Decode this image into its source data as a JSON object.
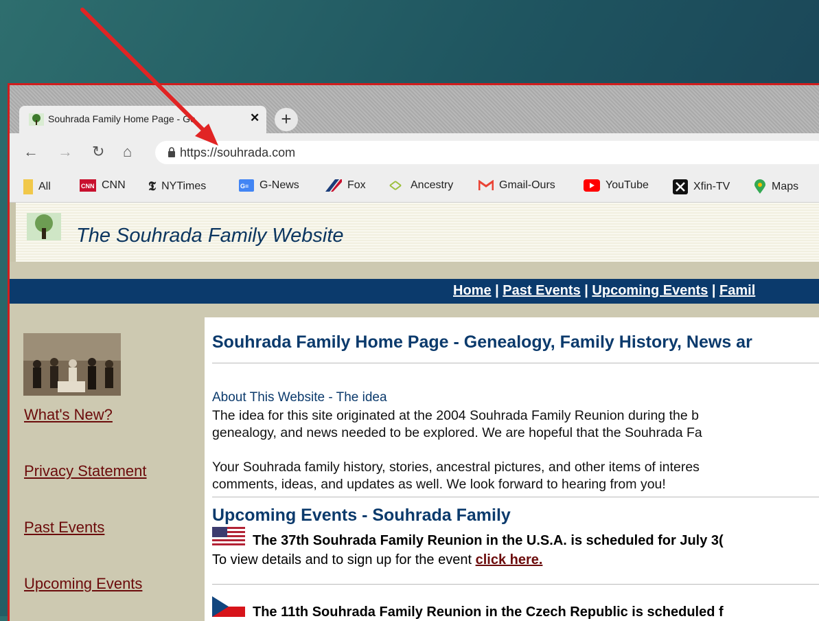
{
  "browser": {
    "tab_title": "Souhrada Family Home Page - Ge",
    "url": "https://souhrada.com",
    "bookmarks": [
      {
        "label": "All",
        "icon": "folder-icon"
      },
      {
        "label": "CNN",
        "icon": "cnn-icon"
      },
      {
        "label": "NYTimes",
        "icon": "nytimes-icon"
      },
      {
        "label": "G-News",
        "icon": "google-news-icon"
      },
      {
        "label": "Fox",
        "icon": "fox-icon"
      },
      {
        "label": "Ancestry",
        "icon": "ancestry-icon"
      },
      {
        "label": "Gmail-Ours",
        "icon": "gmail-icon"
      },
      {
        "label": "YouTube",
        "icon": "youtube-icon"
      },
      {
        "label": "Xfin-TV",
        "icon": "x-icon"
      },
      {
        "label": "Maps",
        "icon": "maps-icon"
      }
    ]
  },
  "site": {
    "title": "The Souhrada Family Website",
    "nav": [
      "Home",
      "Past Events",
      "Upcoming Events",
      "Famil"
    ],
    "sidebar": [
      "What's New?",
      "Privacy Statement",
      "Past Events",
      "Upcoming Events"
    ]
  },
  "content": {
    "heading": "Souhrada Family Home Page - Genealogy, Family History, News ar",
    "about_title": "About This Website - The idea",
    "about_line1": "The idea for this site originated at the 2004 Souhrada Family Reunion during the b",
    "about_line2": "genealogy, and news needed to be explored.  We are hopeful that the Souhrada Fa",
    "about_line3": "Your Souhrada family history, stories, ancestral pictures, and other items of interes",
    "about_line4": "comments, ideas, and updates as well. We look forward to hearing from you!",
    "upcoming_heading": "Upcoming Events - Souhrada Family",
    "event_usa": "The 37th Souhrada Family Reunion in the U.S.A. is scheduled for July 3(",
    "event_usa_details": "To view details and to sign up for the event ",
    "event_usa_link": "click here.",
    "event_czech": "The 11th Souhrada Family Reunion in the Czech Republic is scheduled f"
  }
}
